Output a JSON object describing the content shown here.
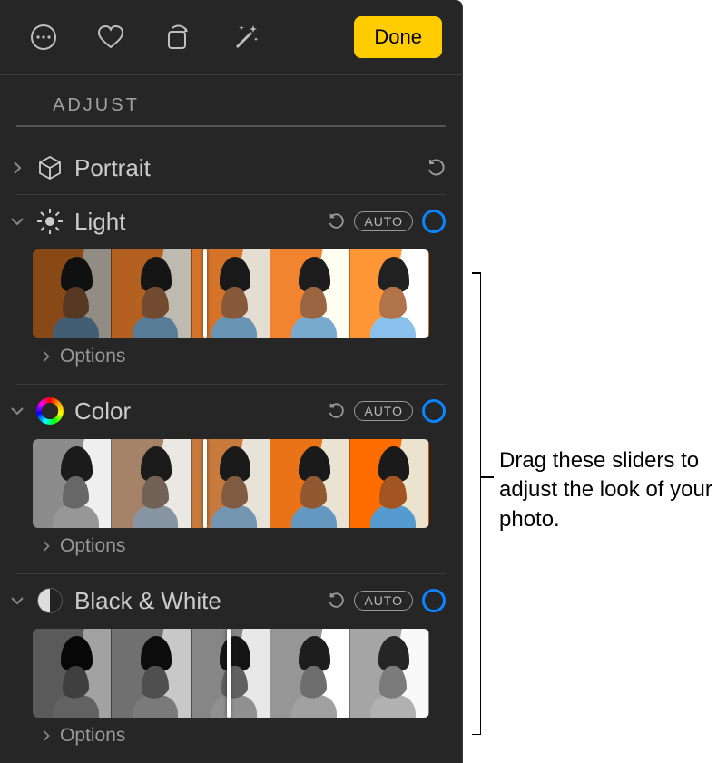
{
  "toolbar": {
    "done_label": "Done"
  },
  "section": {
    "title": "ADJUST"
  },
  "rows": {
    "portrait": {
      "label": "Portrait"
    },
    "light": {
      "label": "Light",
      "auto": "AUTO",
      "options": "Options"
    },
    "color": {
      "label": "Color",
      "auto": "AUTO",
      "options": "Options"
    },
    "bw": {
      "label": "Black & White",
      "auto": "AUTO",
      "options": "Options"
    }
  },
  "callout": {
    "text": "Drag these sliders to adjust the look of your photo."
  }
}
